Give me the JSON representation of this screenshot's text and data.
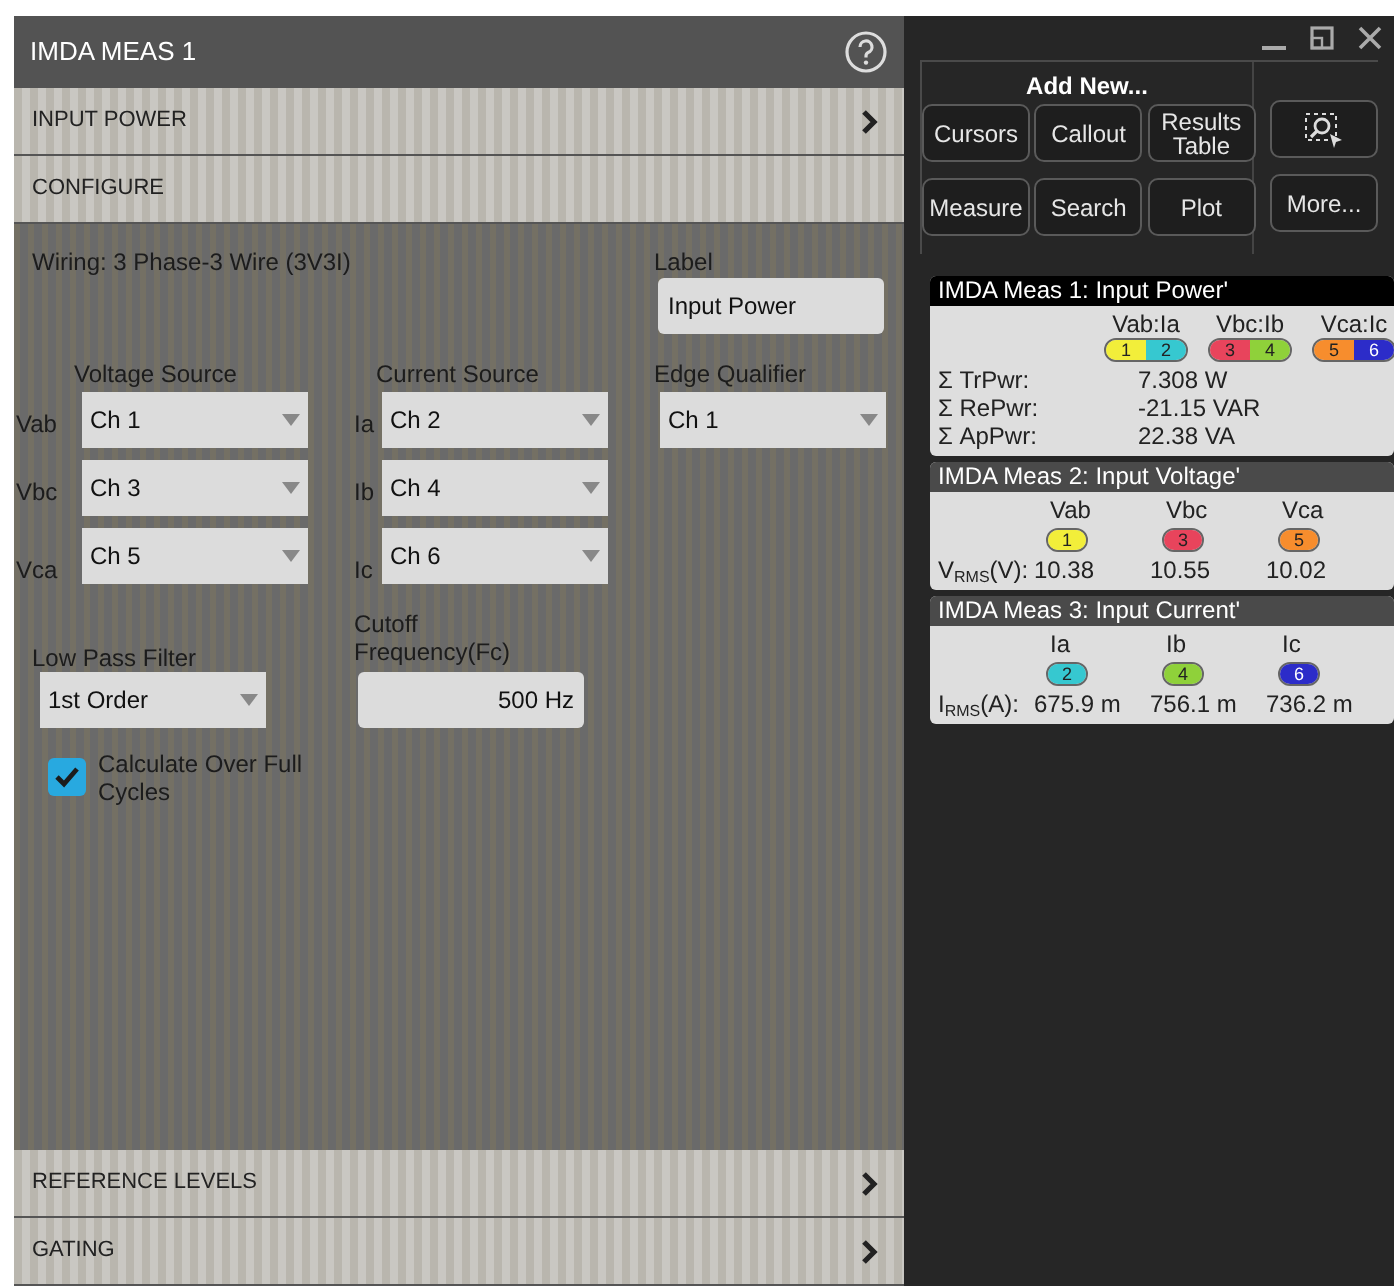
{
  "panel": {
    "title": "IMDA MEAS 1",
    "top_sections": [
      {
        "label": "INPUT POWER",
        "expanded": false
      },
      {
        "label": "CONFIGURE",
        "expanded": true
      }
    ],
    "wiring": "Wiring: 3 Phase-3 Wire (3V3I)",
    "label_field": {
      "label": "Label",
      "value": "Input Power"
    },
    "voltage_source": {
      "heading": "Voltage Source",
      "rows": [
        {
          "label": "Vab",
          "value": "Ch 1"
        },
        {
          "label": "Vbc",
          "value": "Ch 3"
        },
        {
          "label": "Vca",
          "value": "Ch 5"
        }
      ]
    },
    "current_source": {
      "heading": "Current Source",
      "rows": [
        {
          "label": "Ia",
          "value": "Ch 2"
        },
        {
          "label": "Ib",
          "value": "Ch 4"
        },
        {
          "label": "Ic",
          "value": "Ch 6"
        }
      ]
    },
    "edge_qualifier": {
      "heading": "Edge Qualifier",
      "value": "Ch 1"
    },
    "low_pass_filter": {
      "label": "Low Pass Filter",
      "value": "1st Order"
    },
    "cutoff": {
      "label": "Cutoff Frequency(Fc)",
      "value": "500 Hz"
    },
    "full_cycles": {
      "label": "Calculate Over Full Cycles",
      "checked": true
    },
    "bottom_sections": [
      {
        "label": "REFERENCE LEVELS",
        "expanded": false
      },
      {
        "label": "GATING",
        "expanded": false
      }
    ]
  },
  "add_new": {
    "title": "Add New...",
    "buttons": [
      "Cursors",
      "Callout",
      "Results Table",
      "Measure",
      "Search",
      "Plot"
    ],
    "more": "More..."
  },
  "results": [
    {
      "title": "IMDA Meas 1: Input Power'",
      "kind": "power",
      "columns": [
        {
          "label": "Vab:Ia",
          "badges": [
            {
              "text": "1",
              "color": "#f2ee3a"
            },
            {
              "text": "2",
              "color": "#36c8d0"
            }
          ]
        },
        {
          "label": "Vbc:Ib",
          "badges": [
            {
              "text": "3",
              "color": "#e8445c"
            },
            {
              "text": "4",
              "color": "#8fd13a"
            }
          ]
        },
        {
          "label": "Vca:Ic",
          "badges": [
            {
              "text": "5",
              "color": "#f78d2d"
            },
            {
              "text": "6",
              "color": "#2c2cc9"
            }
          ]
        }
      ],
      "rows": [
        {
          "label": "Σ TrPwr:",
          "value": "7.308 W"
        },
        {
          "label": "Σ RePwr:",
          "value": "-21.15 VAR"
        },
        {
          "label": "Σ ApPwr:",
          "value": "22.38 VA"
        }
      ]
    },
    {
      "title": "IMDA Meas 2: Input Voltage'",
      "kind": "table",
      "columns": [
        {
          "label": "Vab",
          "badges": [
            {
              "text": "1",
              "color": "#f2ee3a"
            }
          ]
        },
        {
          "label": "Vbc",
          "badges": [
            {
              "text": "3",
              "color": "#e8445c"
            }
          ]
        },
        {
          "label": "Vca",
          "badges": [
            {
              "text": "5",
              "color": "#f78d2d"
            }
          ]
        }
      ],
      "row_label": "V$_{RMS}$(V):",
      "values": [
        "10.38",
        "10.55",
        "10.02"
      ]
    },
    {
      "title": "IMDA Meas 3: Input Current'",
      "kind": "table",
      "columns": [
        {
          "label": "Ia",
          "badges": [
            {
              "text": "2",
              "color": "#36c8d0"
            }
          ]
        },
        {
          "label": "Ib",
          "badges": [
            {
              "text": "4",
              "color": "#8fd13a"
            }
          ]
        },
        {
          "label": "Ic",
          "badges": [
            {
              "text": "6",
              "color": "#2c2cc9"
            }
          ]
        }
      ],
      "row_label": "I$_{RMS}$(A):",
      "values": [
        "675.9 m",
        "756.1 m",
        "736.2 m"
      ]
    }
  ]
}
